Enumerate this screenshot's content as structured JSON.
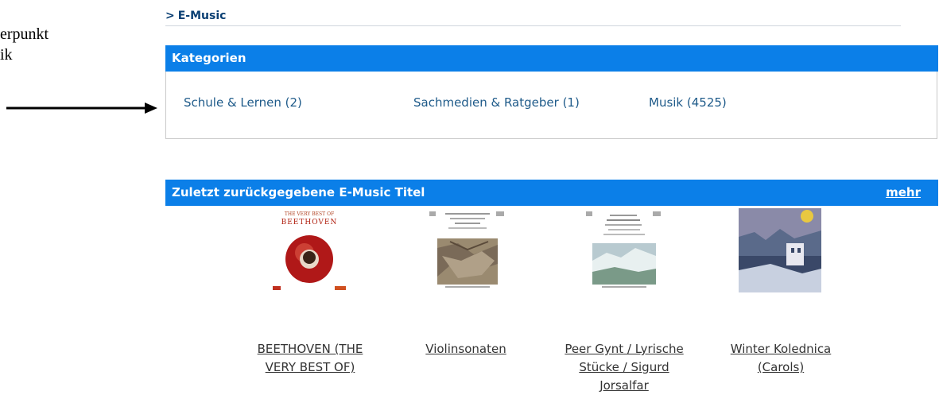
{
  "annotation": {
    "text": "erpunkt\nik"
  },
  "breadcrumb": {
    "chevron": ">",
    "label": "E-Music"
  },
  "categories": {
    "heading": "Kategorien",
    "items": [
      {
        "label": "Schule & Lernen (2)"
      },
      {
        "label": "Sachmedien & Ratgeber (1)"
      },
      {
        "label": "Musik (4525)"
      }
    ]
  },
  "recent": {
    "heading": "Zuletzt zurückgegebene E-Music Titel",
    "more_label": "mehr",
    "items": [
      {
        "title_line1": "BEETHOVEN (THE",
        "title_line2": "VERY BEST OF)",
        "title_line3": "",
        "cover_caption": "THE VERY BEST OF",
        "cover_name": "BEETHOVEN"
      },
      {
        "title_line1": "Violinsonaten",
        "title_line2": "",
        "title_line3": ""
      },
      {
        "title_line1": "Peer Gynt / Lyrische",
        "title_line2": "Stücke / Sigurd",
        "title_line3": "Jorsalfar"
      },
      {
        "title_line1": "Winter Kolednica",
        "title_line2": "(Carols)",
        "title_line3": ""
      }
    ]
  },
  "colors": {
    "accent_bar": "#0b7fe8",
    "link": "#1f5b8a",
    "breadcrumb": "#0a3f73"
  }
}
